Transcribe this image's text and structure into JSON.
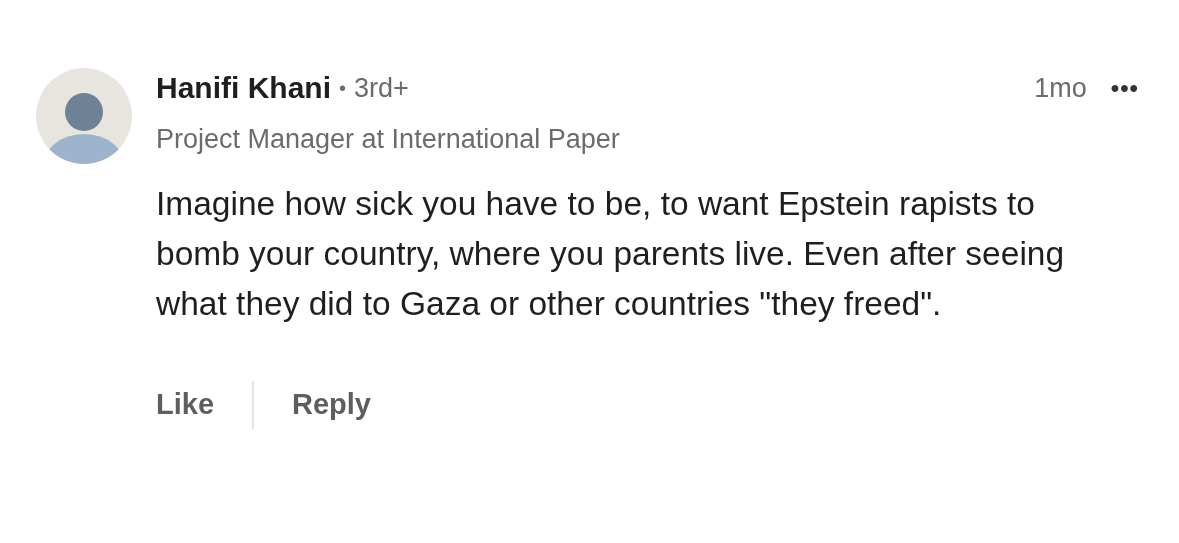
{
  "comment": {
    "author": "Hanifi Khani",
    "separator": "•",
    "degree": "3rd+",
    "headline": "Project Manager at International Paper",
    "time": "1mo",
    "menu": "•••",
    "text": "Imagine how sick you have to be, to want Epstein rapists to bomb your country, where you parents live. Even after seeing what they did to Gaza or other countries \"they freed\".",
    "actions": [
      "Like",
      "Reply"
    ]
  }
}
